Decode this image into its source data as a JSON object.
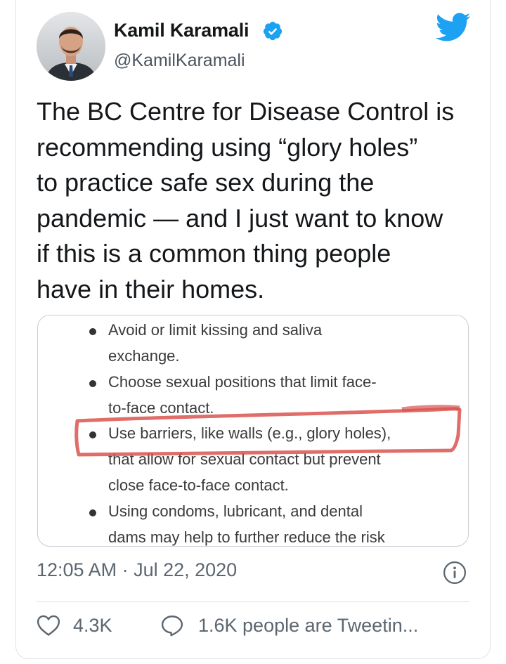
{
  "author": {
    "name": "Kamil Karamali",
    "handle": "@KamilKaramali"
  },
  "tweet": {
    "text_lines": [
      "The BC Centre for Disease Control is",
      "recommending using “glory holes”",
      "to practice safe sex during the",
      "pandemic — and I just want to know",
      "if this is a common thing people",
      "have in their homes."
    ]
  },
  "media": {
    "lines": [
      "Avoid or limit kissing and saliva",
      "exchange.",
      "Choose sexual positions that limit face-",
      "to-face contact.",
      "Use barriers, like walls (e.g., glory holes),",
      "that allow for sexual contact but prevent",
      "close face-to-face contact.",
      "Using condoms, lubricant, and dental",
      "dams may help to further reduce the risk"
    ]
  },
  "meta": {
    "timestamp": "12:05 AM · Jul 22, 2020"
  },
  "actions": {
    "likes": "4.3K",
    "conversation": "1.6K people are Tweetin..."
  },
  "colors": {
    "twitter_blue": "#1da1f2",
    "highlight_red": "#d9534f"
  },
  "icons": [
    "verified-badge-icon",
    "twitter-bird-icon",
    "info-icon",
    "heart-icon",
    "comment-bubble-icon"
  ]
}
